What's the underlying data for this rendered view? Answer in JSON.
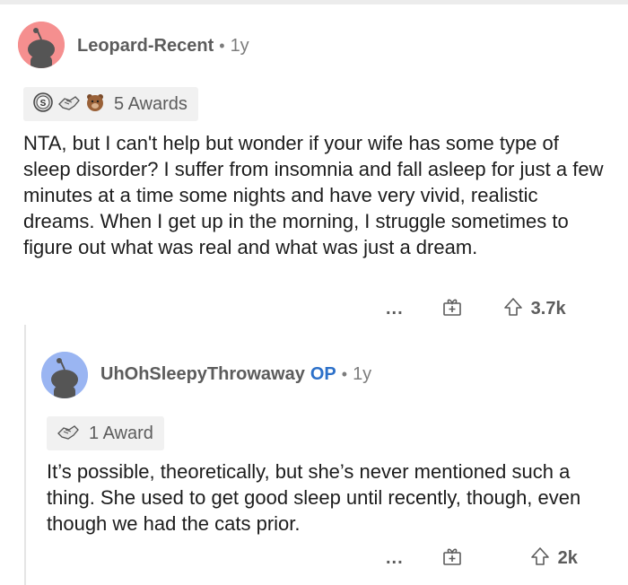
{
  "comments": [
    {
      "username": "Leopard-Recent",
      "age": "1y",
      "awards_label": "5 Awards",
      "award_icons": [
        "silver-award-icon",
        "helpful-award-icon",
        "bear-award-icon"
      ],
      "avatar_color": "#f58f8f",
      "text": "NTA, but I can't help but wonder if your wife has some type of sleep disorder? I suffer from insomnia and fall asleep for just a few minutes at a time some nights and have very vivid, realistic dreams. When I get up in the morning, I struggle sometimes to figure out what was real and what was just a dream.",
      "more": "...",
      "score": "3.7k"
    },
    {
      "username": "UhOhSleepyThrowaway",
      "op_badge": "OP",
      "age": "1y",
      "awards_label": "1 Award",
      "award_icons": [
        "helpful-award-icon"
      ],
      "avatar_color": "#9ab5f2",
      "text": "It’s possible, theoretically, but she’s never mentioned such a thing. She used to get good sleep until recently, though, even though we had the cats prior.",
      "more": "...",
      "score": "2k"
    }
  ],
  "colors": {
    "op": "#2c70c9",
    "meta": "#7c7c7c",
    "award_bg": "#f1f1f1"
  }
}
